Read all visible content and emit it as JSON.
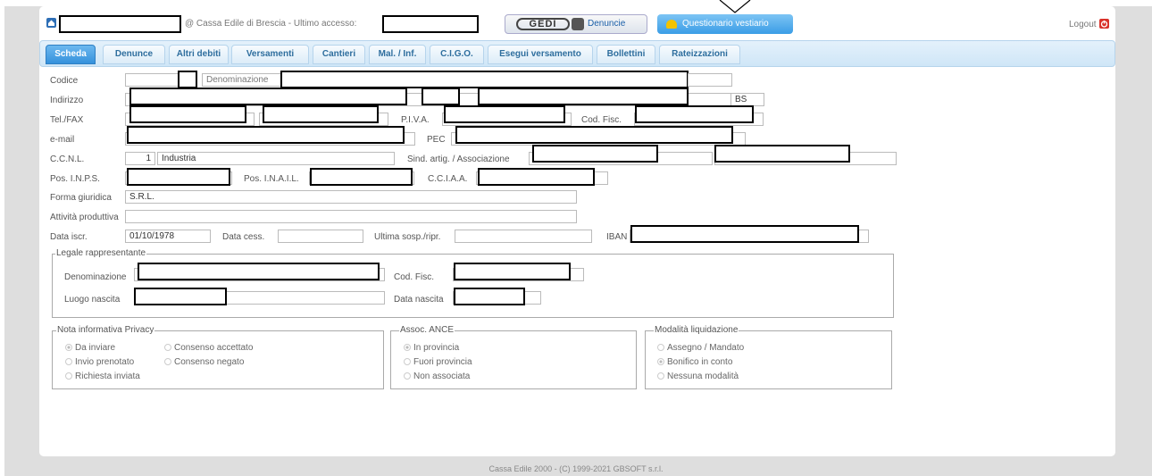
{
  "header": {
    "org_text": "@ Cassa Edile di Brescia - Ultimo accesso:",
    "gedi_logo": "GEDI",
    "denunce_link": "Denuncie",
    "questionario_btn": "Questionario vestiario",
    "logout": "Logout"
  },
  "tabs": [
    "Scheda",
    "Denunce",
    "Altri debiti",
    "Versamenti",
    "Cantieri",
    "Mal. / Inf.",
    "C.I.G.O.",
    "Esegui versamento",
    "Bollettini",
    "Rateizzazioni"
  ],
  "form": {
    "codice_label": "Codice",
    "denominazione_label": "Denominazione",
    "indirizzo_label": "Indirizzo",
    "provincia_value": "BS",
    "telfax_label": "Tel./FAX",
    "piva_label": "P.I.V.A.",
    "codfisc_label": "Cod. Fisc.",
    "email_label": "e-mail",
    "pec_label": "PEC",
    "ccnl_label": "C.C.N.L.",
    "ccnl_code": "1",
    "ccnl_value": "Industria",
    "sind_label": "Sind. artig. / Associazione",
    "inps_label": "Pos. I.N.P.S.",
    "inail_label": "Pos. I.N.A.I.L.",
    "cciaa_label": "C.C.I.A.A.",
    "forma_label": "Forma giuridica",
    "forma_value": "S.R.L.",
    "attivita_label": "Attività produttiva",
    "attivita_value": "",
    "data_iscr_label": "Data iscr.",
    "data_iscr_value": "01/10/1978",
    "data_cess_label": "Data cess.",
    "data_cess_value": "",
    "ultima_label": "Ultima sosp./ripr.",
    "ultima_value": "",
    "iban_label": "IBAN"
  },
  "legale": {
    "legend": "Legale rappresentante",
    "denominazione_label": "Denominazione",
    "codfisc_label": "Cod. Fisc.",
    "luogo_label": "Luogo nascita",
    "data_label": "Data nascita"
  },
  "privacy": {
    "legend": "Nota informativa Privacy",
    "options": [
      "Da inviare",
      "Consenso accettato",
      "Invio prenotato",
      "Consenso negato",
      "Richiesta inviata"
    ],
    "selected": "Da inviare"
  },
  "ance": {
    "legend": "Assoc. ANCE",
    "options": [
      "In provincia",
      "Fuori provincia",
      "Non associata"
    ],
    "selected": "In provincia"
  },
  "liquidazione": {
    "legend": "Modalità liquidazione",
    "options": [
      "Assegno / Mandato",
      "Bonifico in conto",
      "Nessuna modalità"
    ],
    "selected": "Bonifico in conto"
  },
  "footer": "Cassa Edile 2000 - (C) 1999-2021 GBSOFT s.r.l."
}
